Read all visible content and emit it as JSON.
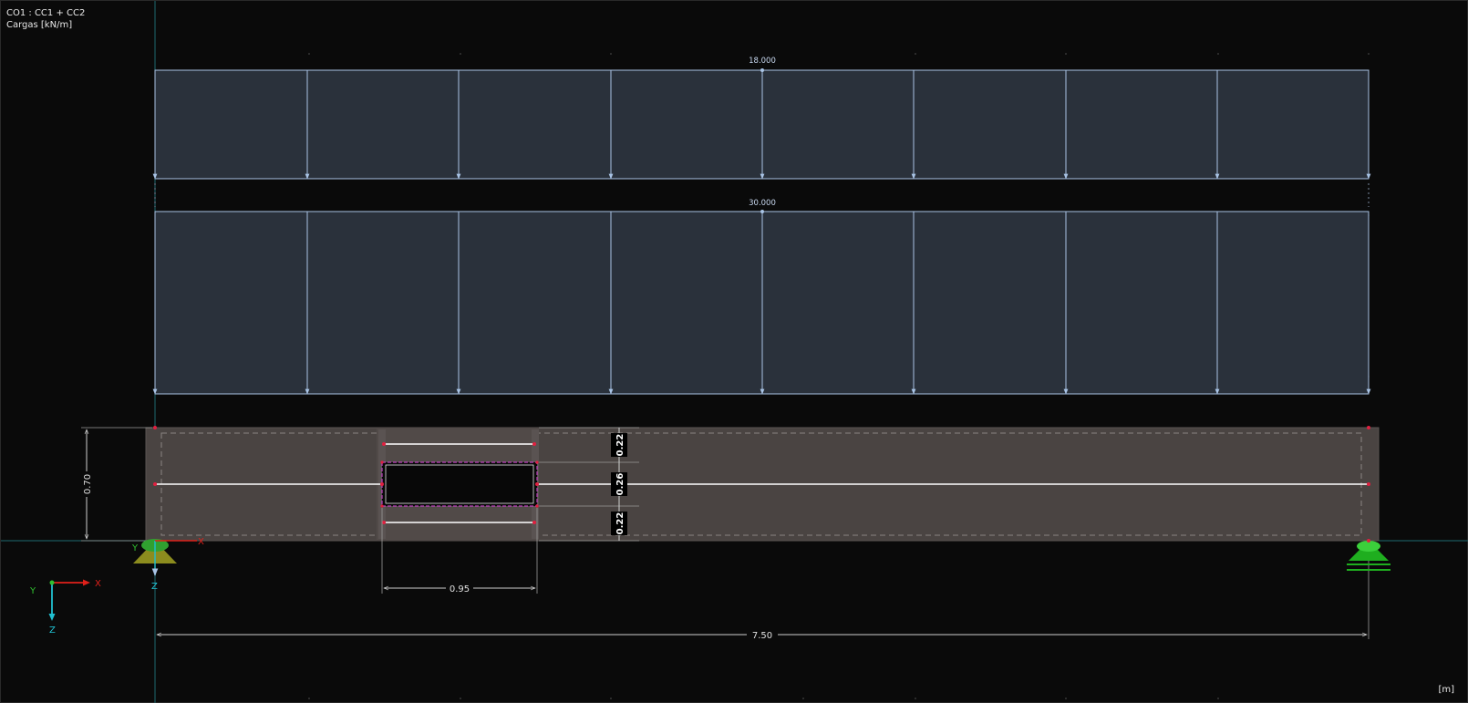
{
  "header": {
    "combination": "CO1 : CC1 + CC2",
    "loads_label": "Cargas [kN/m]"
  },
  "units": "[m]",
  "loads": {
    "upper_value": "18.000",
    "lower_value": "30.000"
  },
  "dimensions": {
    "beam_height": "0.70",
    "opening_width": "0.95",
    "beam_length": "7.50",
    "top_segment": "0.22",
    "opening_height": "0.26",
    "bottom_segment": "0.22"
  },
  "axes": {
    "x": "X",
    "y": "Y",
    "z": "Z"
  },
  "colors": {
    "background": "#0a0a0a",
    "load_fill": "#2a313b",
    "load_line": "#a9c4e6",
    "beam_fill": "#4a4442",
    "support_left": "#9a9a20",
    "support_right": "#1fae1f",
    "axis_x": "#e0201a",
    "axis_z": "#20c0d0",
    "axis_y": "#30c030"
  }
}
